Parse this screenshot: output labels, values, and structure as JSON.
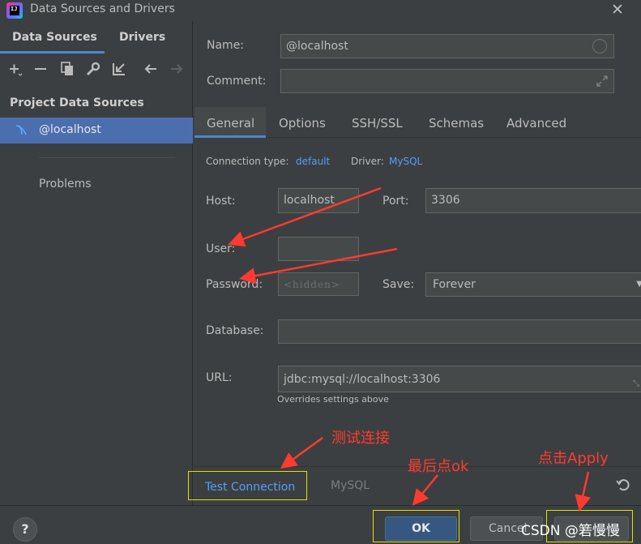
{
  "window": {
    "app_icon_text": "IJ",
    "title": "Data Sources and Drivers",
    "close_glyph": "✕"
  },
  "sidebar": {
    "tabs": [
      {
        "label": "Data Sources",
        "active": true
      },
      {
        "label": "Drivers",
        "active": false
      }
    ],
    "toolbar": [
      "add-icon",
      "remove-icon",
      "duplicate-icon",
      "wrench-icon",
      "import-icon",
      "back-arrow-icon",
      "forward-arrow-icon"
    ],
    "section_title": "Project Data Sources",
    "items": [
      {
        "label": "@localhost",
        "selected": true
      }
    ],
    "problems_label": "Problems"
  },
  "form": {
    "name_label": "Name:",
    "name_value": "@localhost",
    "comment_label": "Comment:",
    "comment_value": "",
    "tabs": [
      {
        "label": "General",
        "active": true
      },
      {
        "label": "Options"
      },
      {
        "label": "SSH/SSL"
      },
      {
        "label": "Schemas"
      },
      {
        "label": "Advanced"
      }
    ],
    "connection_type_label": "Connection type:",
    "connection_type_value": "default",
    "driver_label": "Driver:",
    "driver_value": "MySQL",
    "host_label": "Host:",
    "host_value": "localhost",
    "port_label": "Port:",
    "port_value": "3306",
    "user_label": "User:",
    "user_value": "",
    "password_label": "Password:",
    "password_placeholder": "<hidden>",
    "save_label": "Save:",
    "save_value": "Forever",
    "database_label": "Database:",
    "database_value": "",
    "url_label": "URL:",
    "url_value": "jdbc:mysql://localhost:3306",
    "url_hint": "Overrides settings above"
  },
  "footer": {
    "test_connection": "Test Connection",
    "driver_link": "MySQL"
  },
  "buttons": {
    "help": "?",
    "ok": "OK",
    "cancel": "Cancel"
  },
  "annotations": {
    "test": "测试连接",
    "ok": "最后点ok",
    "apply": "点击Apply"
  },
  "watermark": "CSDN @箬慢慢",
  "colors": {
    "background": "#3c3f41",
    "selection": "#4b6eaf",
    "accent": "#4a88c7",
    "link": "#589df6",
    "annotation": "#ff3a30",
    "highlight_box": "#e3e000"
  }
}
